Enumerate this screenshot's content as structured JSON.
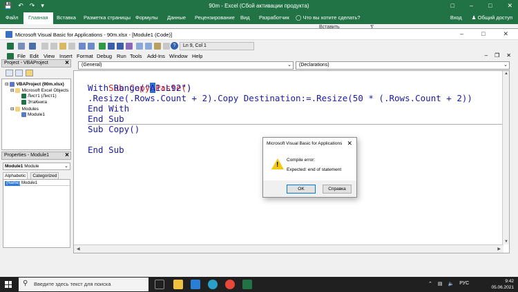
{
  "excel": {
    "title": "90m - Excel (Сбой активации продукта)",
    "ribbon_tabs": [
      "Файл",
      "Главная",
      "Вставка",
      "Разметка страницы",
      "Формулы",
      "Данные",
      "Рецензирование",
      "Вид",
      "Разработчик"
    ],
    "tell_me": "Что вы хотите сделать?",
    "signin": "Вход",
    "share": "Общий доступ",
    "insert_btn": "Вставить"
  },
  "vbe": {
    "title": "Microsoft Visual Basic for Applications - 90m.xlsx - [Module1 (Code)]",
    "position": "Ln 9, Col 1",
    "menu": [
      "File",
      "Edit",
      "View",
      "Insert",
      "Format",
      "Debug",
      "Run",
      "Tools",
      "Add-Ins",
      "Window",
      "Help"
    ]
  },
  "project": {
    "header": "Project - VBAProject",
    "tree": {
      "root": "VBAProject (90m.xlsx)",
      "objects_folder": "Microsoft Excel Objects",
      "sheet": "Лист1 (Лист1)",
      "workbook": "ЭтаКнига",
      "modules_folder": "Modules",
      "module": "Module1"
    }
  },
  "properties": {
    "header": "Properties - Module1",
    "object": "Module1",
    "object_type": "Module",
    "tabs": [
      "Alphabetic",
      "Categorized"
    ],
    "name_key": "(Name)",
    "name_value": "Module1"
  },
  "code": {
    "general": "(General)",
    "declarations": "(Declarations)",
    "line1_kw": "Sub",
    "line1_a": " Copy",
    "line1_cursor": "-",
    "line1_b": "Paste()",
    "line2": "With Range(\"A1:L92\")",
    "line3": ".Resize(.Rows.Count + 2).Copy Destination:=.Resize(50 * (.Rows.Count + 2))",
    "line4": "End With",
    "line5": "End Sub",
    "line6": "Sub Copy()",
    "line7": "End Sub"
  },
  "dialog": {
    "title": "Microsoft Visual Basic for Applications",
    "message1": "Compile error:",
    "message2": "Expected: end of statement",
    "ok": "OK",
    "help": "Справка"
  },
  "taskbar": {
    "search_placeholder": "Введите здесь текст для поиска",
    "lang": "РУС",
    "time": "9:42",
    "date": "05.06.2021"
  },
  "colors": {
    "excel_green": "#217346",
    "keyword_blue": "#1a1aa8",
    "error_red": "#e0201c",
    "warning_yellow": "#f2c811"
  }
}
